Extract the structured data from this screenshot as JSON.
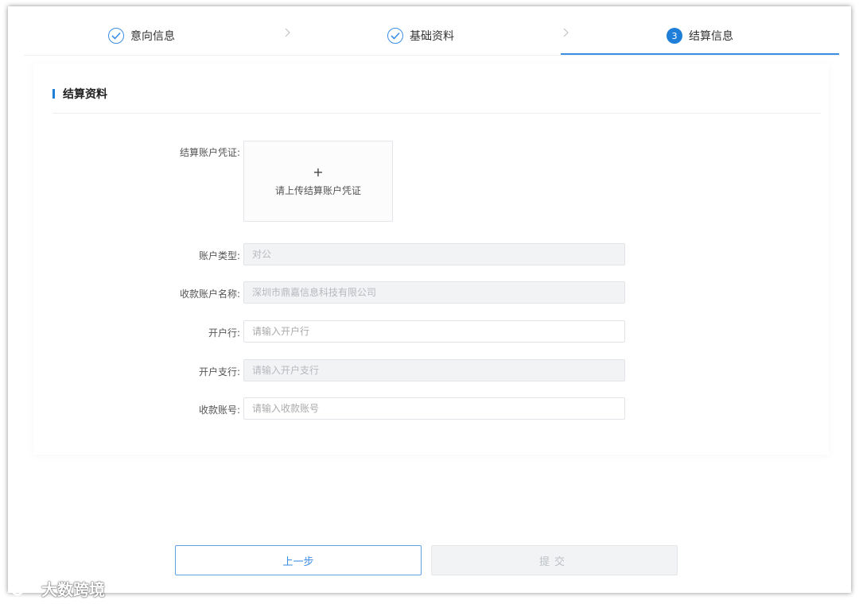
{
  "steps": [
    {
      "label": "意向信息",
      "status": "done"
    },
    {
      "label": "基础资料",
      "status": "done"
    },
    {
      "label": "结算信息",
      "status": "active",
      "number": "3"
    }
  ],
  "section": {
    "title": "结算资料"
  },
  "form": {
    "voucher_label": "结算账户凭证:",
    "voucher_upload_plus": "+",
    "voucher_upload_text": "请上传结算账户凭证",
    "account_type_label": "账户类型:",
    "account_type_value": "对公",
    "payee_name_label": "收款账户名称:",
    "payee_name_value": "深圳市鼎嘉信息科技有限公司",
    "bank_label": "开户行:",
    "bank_placeholder": "请输入开户行",
    "branch_label": "开户支行:",
    "branch_placeholder": "请输入开户支行",
    "account_no_label": "收款账号:",
    "account_no_placeholder": "请输入收款账号"
  },
  "buttons": {
    "prev": "上一步",
    "submit": "提交"
  },
  "watermark": {
    "text": "大数跨境"
  },
  "colors": {
    "accent": "#1f7fd8",
    "border": "#e0e3e8",
    "disabled_bg": "#f2f3f5"
  }
}
